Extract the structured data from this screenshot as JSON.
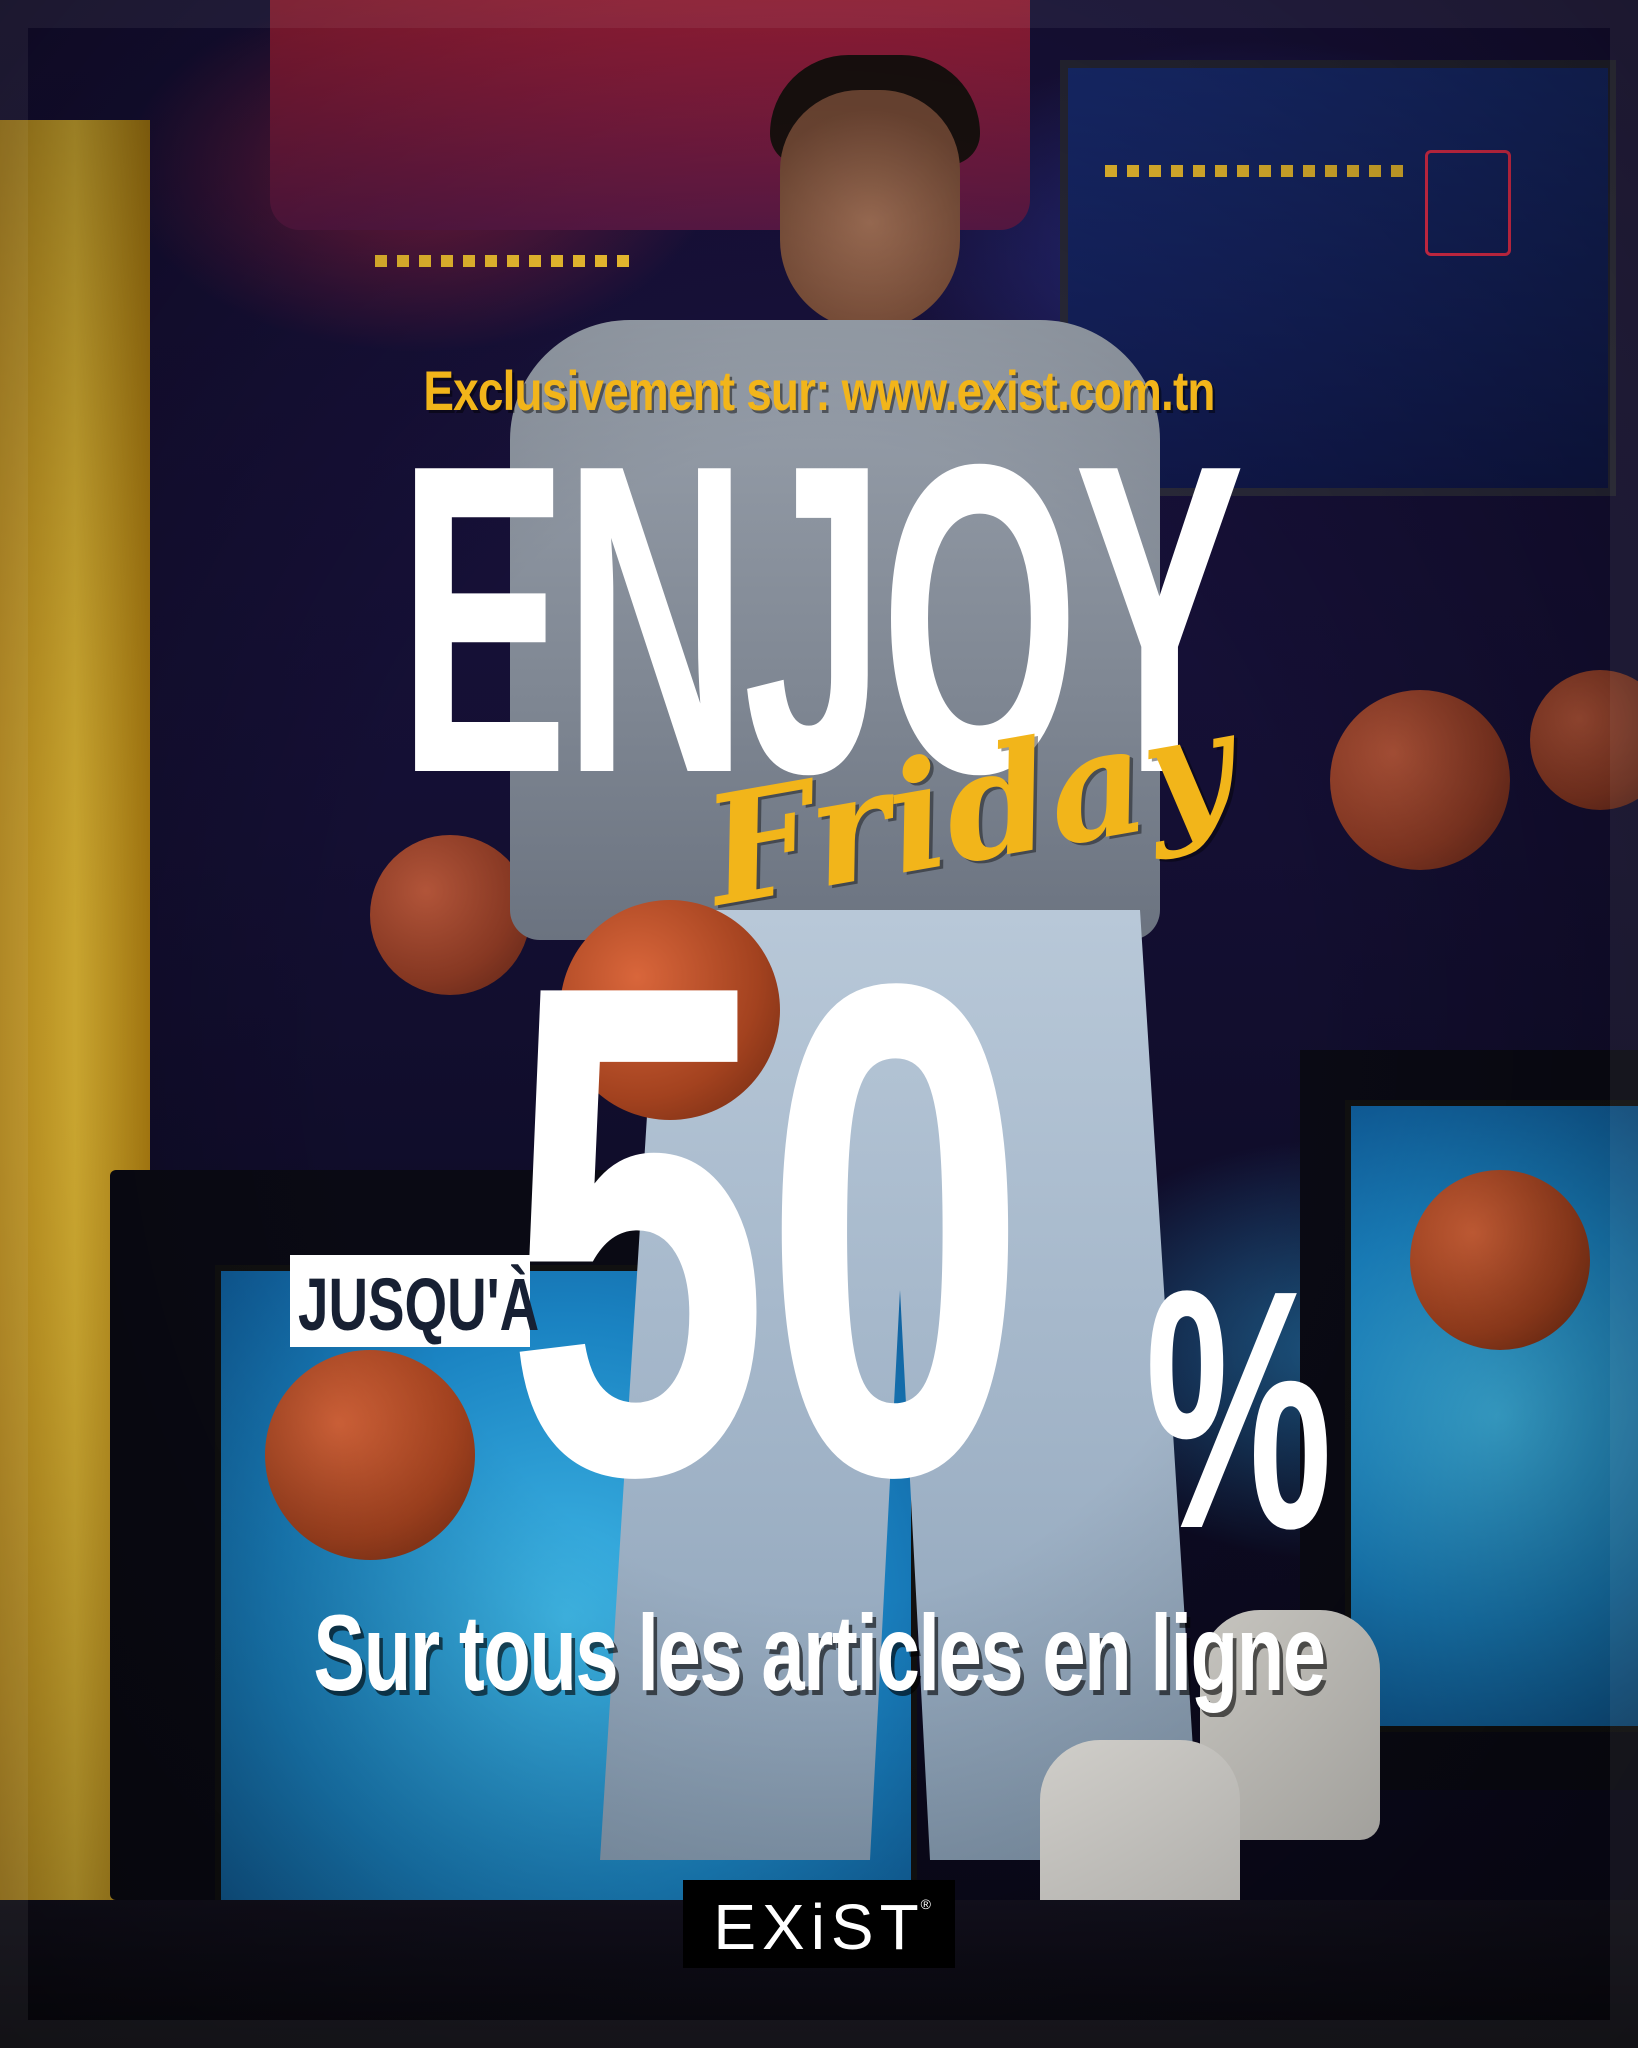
{
  "headline": {
    "exclusive_line": "Exclusivement sur: www.exist.com.tn",
    "word_main": "ENJOY",
    "word_script": "Friday"
  },
  "offer": {
    "prefix": "JUSQU'À",
    "amount": "50",
    "percent_sign": "%",
    "subtitle": "Sur tous les articles en ligne"
  },
  "brand": {
    "logo_text": "EXiST",
    "registered_mark": "®"
  },
  "colors": {
    "accent_yellow": "#f2b51a",
    "text_white": "#ffffff",
    "badge_text": "#172033"
  }
}
